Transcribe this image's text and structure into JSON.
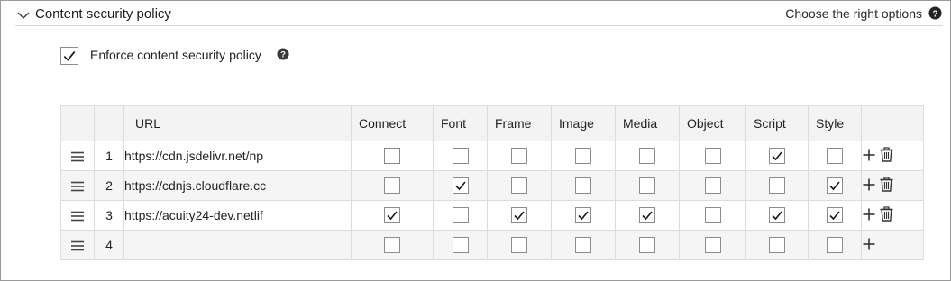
{
  "section": {
    "title": "Content security policy",
    "help_text": "Choose the right options"
  },
  "enforce": {
    "label": "Enforce content security policy",
    "checked": true
  },
  "table": {
    "columns": [
      "URL",
      "Connect",
      "Font",
      "Frame",
      "Image",
      "Media",
      "Object",
      "Script",
      "Style"
    ],
    "rows": [
      {
        "num": "1",
        "url": "https://cdn.jsdelivr.net/np",
        "checks": [
          false,
          false,
          false,
          false,
          false,
          false,
          true,
          false
        ],
        "can_delete": true
      },
      {
        "num": "2",
        "url": "https://cdnjs.cloudflare.cc",
        "checks": [
          false,
          true,
          false,
          false,
          false,
          false,
          false,
          true
        ],
        "can_delete": true
      },
      {
        "num": "3",
        "url": "https://acuity24-dev.netlif",
        "checks": [
          true,
          false,
          true,
          true,
          true,
          false,
          true,
          true
        ],
        "can_delete": true
      },
      {
        "num": "4",
        "url": "",
        "checks": [
          false,
          false,
          false,
          false,
          false,
          false,
          false,
          false
        ],
        "can_delete": false
      }
    ]
  },
  "icons": {
    "collapse": "chevron-down-icon",
    "help": "question-circle-icon",
    "drag": "drag-handle-icon",
    "add": "plus-icon",
    "delete": "trash-icon",
    "check": "checkmark-icon"
  }
}
